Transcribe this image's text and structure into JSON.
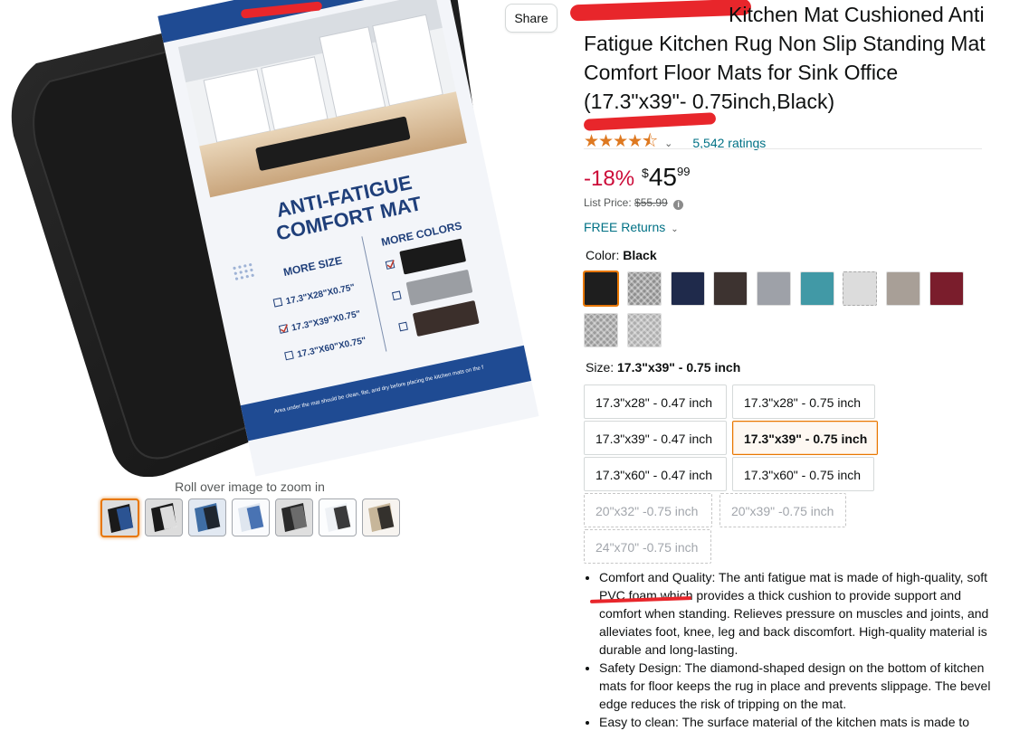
{
  "share_label": "Share",
  "zoom_hint": "Roll over image to zoom in",
  "image_panel": {
    "headline": "ANTI-FATIGUE COMFORT MAT",
    "more_size_label": "MORE SIZE",
    "more_colors_label": "MORE COLORS",
    "size_options": [
      "17.3\"X28\"X0.75\"",
      "17.3\"X39\"X0.75\"",
      "17.3\"X60\"X0.75\""
    ],
    "checked_size": "17.3\"X39\"X0.75\"",
    "footnote": "Area under the mat should be clean, flat, and dry before placing the kitchen mats on the floor. Water or dust under mat may cause slippage."
  },
  "thumbnail_count": 7,
  "product": {
    "title": "Kitchen Mat Cushioned Anti Fatigue Kitchen Rug Non Slip Standing Mat Comfort Floor Mats for Sink Office (17.3\"x39\"- 0.75inch,Black)",
    "rating_stars": 4.5,
    "ratings_text": "5,542 ratings",
    "discount": "-18%",
    "price_currency": "$",
    "price_whole": "45",
    "price_fraction": "99",
    "list_price_label": "List Price:",
    "list_price": "$55.99",
    "free_returns": "FREE Returns"
  },
  "color": {
    "label": "Color:",
    "selected": "Black",
    "swatches": [
      {
        "name": "swatch-black",
        "color": "#1e1e1e"
      },
      {
        "name": "swatch-grey-pattern",
        "color": "#8e8e8e",
        "pattern": true
      },
      {
        "name": "swatch-navy",
        "color": "#1f2a4b"
      },
      {
        "name": "swatch-brown",
        "color": "#3d3330"
      },
      {
        "name": "swatch-light-grey",
        "color": "#9ea1a8"
      },
      {
        "name": "swatch-teal",
        "color": "#4199a6"
      },
      {
        "name": "swatch-white",
        "color": "#dcdcdc",
        "dashed": true
      },
      {
        "name": "swatch-taupe",
        "color": "#a89f97"
      },
      {
        "name": "swatch-burgundy",
        "color": "#7a1d2c"
      },
      {
        "name": "swatch-grey-texture-1",
        "color": "#9a9a9a",
        "pattern": true
      },
      {
        "name": "swatch-grey-texture-2",
        "color": "#adadad",
        "pattern": true
      }
    ]
  },
  "size": {
    "label": "Size:",
    "selected": "17.3\"x39\" - 0.75 inch",
    "options": [
      "17.3\"x28\" - 0.47 inch",
      "17.3\"x28\" - 0.75 inch",
      "17.3\"x39\" - 0.47 inch",
      "17.3\"x39\" - 0.75 inch",
      "17.3\"x60\" - 0.47 inch",
      "17.3\"x60\" - 0.75 inch",
      "20\"x32\" -0.75 inch",
      "20\"x39\" -0.75 inch",
      "24\"x70\" -0.75 inch"
    ]
  },
  "bullets": [
    "Comfort and Quality: The anti fatigue mat is made of high-quality, soft PVC foam which provides a thick cushion to provide support and comfort when standing. Relieves pressure on muscles and joints, and alleviates foot, knee, leg and back discomfort. High-quality material is durable and long-lasting.",
    "Safety Design: The diamond-shaped design on the bottom of kitchen mats for floor keeps the rug in place and prevents slippage. The bevel edge reduces the risk of tripping on the mat.",
    "Easy to clean: The surface material of the kitchen mats is made to"
  ],
  "colors": {
    "accent_orange": "#e77600",
    "link_teal": "#007185",
    "discount_red": "#cc0c39",
    "star_orange": "#de7921",
    "redaction_red": "#e8262b"
  }
}
